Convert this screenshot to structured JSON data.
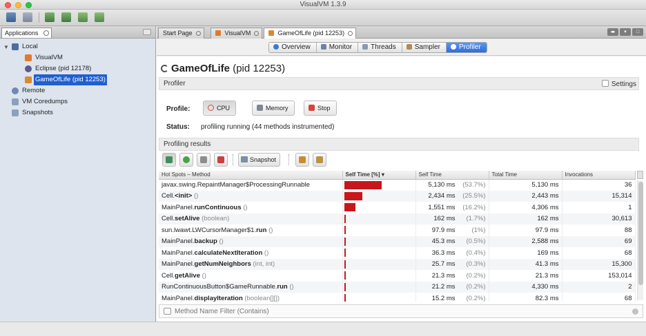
{
  "window": {
    "title": "VisualVM 1.3.9"
  },
  "toolbar": {
    "buttons": [
      "open-icon",
      "save-icon",
      "add-jmx-icon",
      "add-host-icon",
      "add-coredump-icon",
      "add-snapshot-icon"
    ]
  },
  "left_panel": {
    "tab_label": "Applications",
    "tree": {
      "local": "Local",
      "visualvm": "VisualVM",
      "eclipse": "Eclipse (pid 12178)",
      "gameoflife": "GameOfLife (pid 12253)",
      "remote": "Remote",
      "coredumps": "VM Coredumps",
      "snapshots": "Snapshots"
    }
  },
  "editor_tabs": {
    "start_page": "Start Page",
    "visualvm": "VisualVM",
    "gameoflife": "GameOfLife (pid 12253)"
  },
  "subtabs": {
    "overview": "Overview",
    "monitor": "Monitor",
    "threads": "Threads",
    "sampler": "Sampler",
    "profiler": "Profiler"
  },
  "main": {
    "app_name": "GameOfLife",
    "app_pid": "(pid 12253)",
    "profiler_section": "Profiler",
    "settings_label": "Settings",
    "profile_label": "Profile:",
    "cpu_label": "CPU",
    "memory_label": "Memory",
    "stop_label": "Stop",
    "status_label": "Status:",
    "status_value": "profiling running (44 methods instrumented)",
    "results_section": "Profiling results",
    "snapshot_label": "Snapshot",
    "filter_placeholder": "Method Name Filter (Contains)"
  },
  "table": {
    "columns": [
      "Hot Spots – Method",
      "Self Time [%]",
      "Self Time",
      "Total Time",
      "Invocations"
    ],
    "rows": [
      {
        "cls": "javax.swing.RepaintManager$ProcessingRunnable",
        "name": "",
        "args": "",
        "self_pct": 53.7,
        "self_time": "5,130 ms",
        "self_pct_label": "(53.7%)",
        "total_time": "5,130 ms",
        "invocations": "36"
      },
      {
        "cls": "Cell.",
        "name": "<init>",
        "args": "()",
        "self_pct": 25.5,
        "self_time": "2,434 ms",
        "self_pct_label": "(25.5%)",
        "total_time": "2,443 ms",
        "invocations": "15,314"
      },
      {
        "cls": "MainPanel.",
        "name": "runContinuous",
        "args": "()",
        "self_pct": 16.2,
        "self_time": "1,551 ms",
        "self_pct_label": "(16.2%)",
        "total_time": "4,306 ms",
        "invocations": "1"
      },
      {
        "cls": "Cell.",
        "name": "setAlive",
        "args": "(boolean)",
        "self_pct": 1.7,
        "self_time": "162 ms",
        "self_pct_label": "(1.7%)",
        "total_time": "162 ms",
        "invocations": "30,613"
      },
      {
        "cls": "sun.lwawt.LWCursorManager$1.",
        "name": "run",
        "args": "()",
        "self_pct": 1.0,
        "self_time": "97.9 ms",
        "self_pct_label": "(1%)",
        "total_time": "97.9 ms",
        "invocations": "88"
      },
      {
        "cls": "MainPanel.",
        "name": "backup",
        "args": "()",
        "self_pct": 0.5,
        "self_time": "45.3 ms",
        "self_pct_label": "(0.5%)",
        "total_time": "2,588 ms",
        "invocations": "69"
      },
      {
        "cls": "MainPanel.",
        "name": "calculateNextIteration",
        "args": "()",
        "self_pct": 0.4,
        "self_time": "36.3 ms",
        "self_pct_label": "(0.4%)",
        "total_time": "169 ms",
        "invocations": "68"
      },
      {
        "cls": "MainPanel.",
        "name": "getNumNeighbors",
        "args": "(int, int)",
        "self_pct": 0.3,
        "self_time": "25.7 ms",
        "self_pct_label": "(0.3%)",
        "total_time": "41.3 ms",
        "invocations": "15,300"
      },
      {
        "cls": "Cell.",
        "name": "getAlive",
        "args": "()",
        "self_pct": 0.2,
        "self_time": "21.3 ms",
        "self_pct_label": "(0.2%)",
        "total_time": "21.3 ms",
        "invocations": "153,014"
      },
      {
        "cls": "RunContinuousButton$GameRunnable.",
        "name": "run",
        "args": "()",
        "self_pct": 0.2,
        "self_time": "21.2 ms",
        "self_pct_label": "(0.2%)",
        "total_time": "4,330 ms",
        "invocations": "2"
      },
      {
        "cls": "MainPanel.",
        "name": "displayIteration",
        "args": "(boolean[][])",
        "self_pct": 0.2,
        "self_time": "15.2 ms",
        "self_pct_label": "(0.2%)",
        "total_time": "82.3 ms",
        "invocations": "68"
      }
    ]
  },
  "colors": {
    "accent": "#2d6ad9",
    "bar": "#c8161d",
    "selection": "#1f5fd0"
  }
}
